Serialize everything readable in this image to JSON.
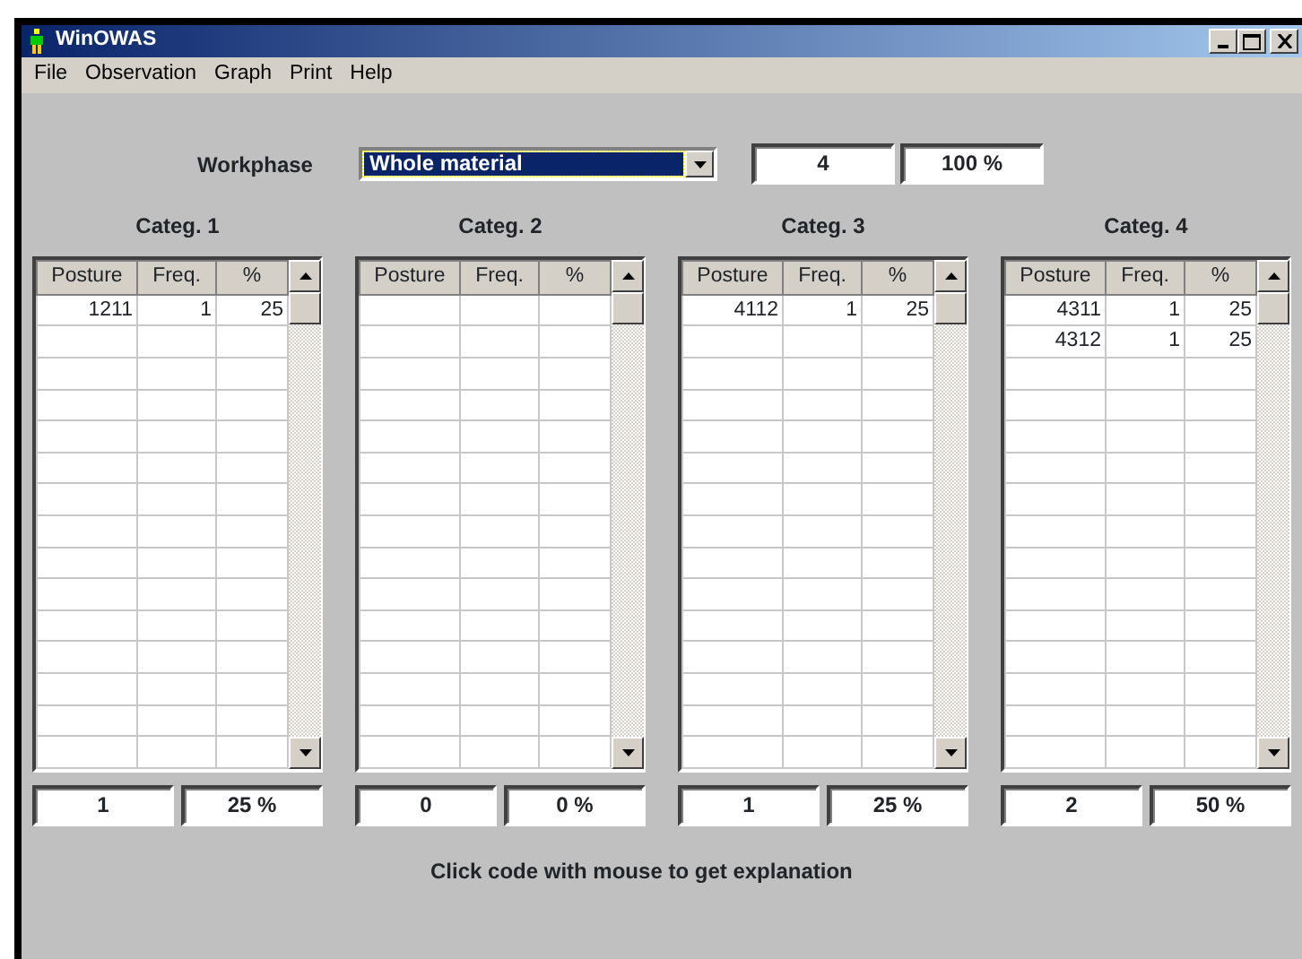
{
  "window": {
    "title": "WinOWAS"
  },
  "menu": [
    "File",
    "Observation",
    "Graph",
    "Print",
    "Help"
  ],
  "workphase": {
    "label": "Workphase",
    "value": "Whole material",
    "count": "4",
    "percent": "100 %"
  },
  "categories": [
    {
      "title": "Categ. 1",
      "columns": [
        "Posture",
        "Freq.",
        "%"
      ],
      "rows": [
        [
          "1211",
          "1",
          "25"
        ]
      ],
      "count": "1",
      "percent": "25 %"
    },
    {
      "title": "Categ. 2",
      "columns": [
        "Posture",
        "Freq.",
        "%"
      ],
      "count": "0",
      "percent": "0 %"
    },
    {
      "title": "Categ. 3",
      "columns": [
        "Posture",
        "Freq.",
        "%"
      ],
      "rows": [
        [
          "4112",
          "1",
          "25"
        ]
      ],
      "count": "1",
      "percent": "25 %"
    },
    {
      "title": "Categ. 4",
      "columns": [
        "Posture",
        "Freq.",
        "%"
      ],
      "rows": [
        [
          "4311",
          "1",
          "25"
        ],
        [
          "4312",
          "1",
          "25"
        ]
      ],
      "count": "2",
      "percent": "50 %"
    }
  ],
  "hint": "Click code with mouse to get explanation"
}
